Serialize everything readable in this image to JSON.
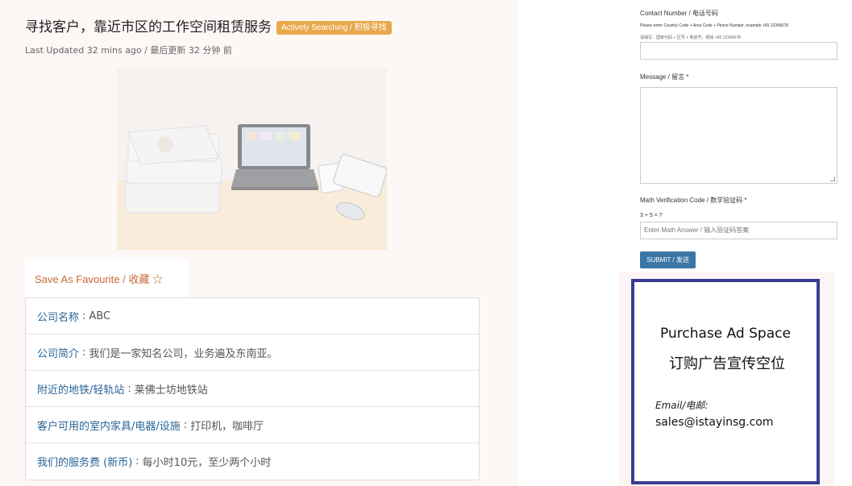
{
  "listing": {
    "title": "寻找客户，靠近市区的工作空间租赁服务",
    "status_badge": "Actively Searching / 积极寻找",
    "last_updated": "Last Updated 32 mins ago / 最后更新 32 分钟 前",
    "favourite_label": "Save As Favourite / 收藏 ☆"
  },
  "details": [
    {
      "label": "公司名称",
      "value": "ABC"
    },
    {
      "label": "公司简介",
      "value": "我们是一家知名公司，业务遍及东南亚。"
    },
    {
      "label": "附近的地铁/轻轨站",
      "value": "莱佛士坊地铁站"
    },
    {
      "label": "客户可用的室内家具/电器/设施",
      "value": "打印机，咖啡厅"
    },
    {
      "label": "我们的服务费 (新币)",
      "value": "每小时10元，至少两个小时"
    }
  ],
  "form": {
    "contact_label": "Contact Number / 电话号码",
    "contact_hint_en": "Please enter Country Code + Area Code + Phone Number, example +65 12345678",
    "contact_hint_cn": "请填写：国家代码 + 区号 + 电话号，例如 +65 12345678",
    "message_label": "Message / 留言 *",
    "math_label": "Math Verification Code / 数学验证码 *",
    "math_question": "3 + 5 = ?",
    "math_placeholder": "Enter Math Answer / 输入验证码答案",
    "submit_label": "SUBMIT / 发送"
  },
  "ad": {
    "title_en": "Purchase Ad Space",
    "title_cn": "订购广告宣传空位",
    "email_label": "Email/电邮:",
    "email": "sales@istayinsg.com"
  },
  "colors": {
    "badge": "#e8a94c",
    "favourite": "#c9673a",
    "link_label": "#2a6496",
    "submit": "#3a77a7",
    "ad_border": "#3a3d93"
  }
}
